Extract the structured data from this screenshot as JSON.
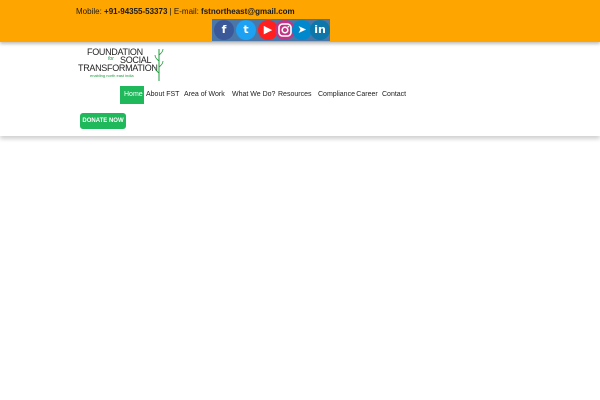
{
  "topbar": {
    "mobile_label": "Mobile: ",
    "mobile_number": "+91-94355-53373",
    "separator": " | E-mail: ",
    "email": "fstnortheast@gmail.com",
    "background": "#ffa500"
  },
  "social": [
    {
      "icon": "facebook-icon",
      "glyph": "f"
    },
    {
      "icon": "twitter-icon",
      "glyph": "t"
    },
    {
      "icon": "youtube-icon",
      "glyph": "▶"
    },
    {
      "icon": "instagram-icon",
      "glyph": ""
    },
    {
      "icon": "telegram-icon",
      "glyph": "➤"
    },
    {
      "icon": "linkedin-icon",
      "glyph": "in"
    }
  ],
  "logo": {
    "line1": "FOUNDATION",
    "for": "for",
    "line2": "SOCIAL",
    "line3": "TRANSFORMATION",
    "tagline": "enabling north east india"
  },
  "nav": {
    "items": [
      {
        "label": "Home",
        "active": true
      },
      {
        "label": "About FST",
        "active": false
      },
      {
        "label": "Area of Work",
        "active": false
      },
      {
        "label": "What We Do?",
        "active": false
      },
      {
        "label": "Resources",
        "active": false
      },
      {
        "label": "Compliance",
        "active": false
      },
      {
        "label": "Career",
        "active": false
      },
      {
        "label": "Contact",
        "active": false
      }
    ],
    "accent": "#1fb85a"
  },
  "donate": {
    "label": "DONATE NOW"
  }
}
